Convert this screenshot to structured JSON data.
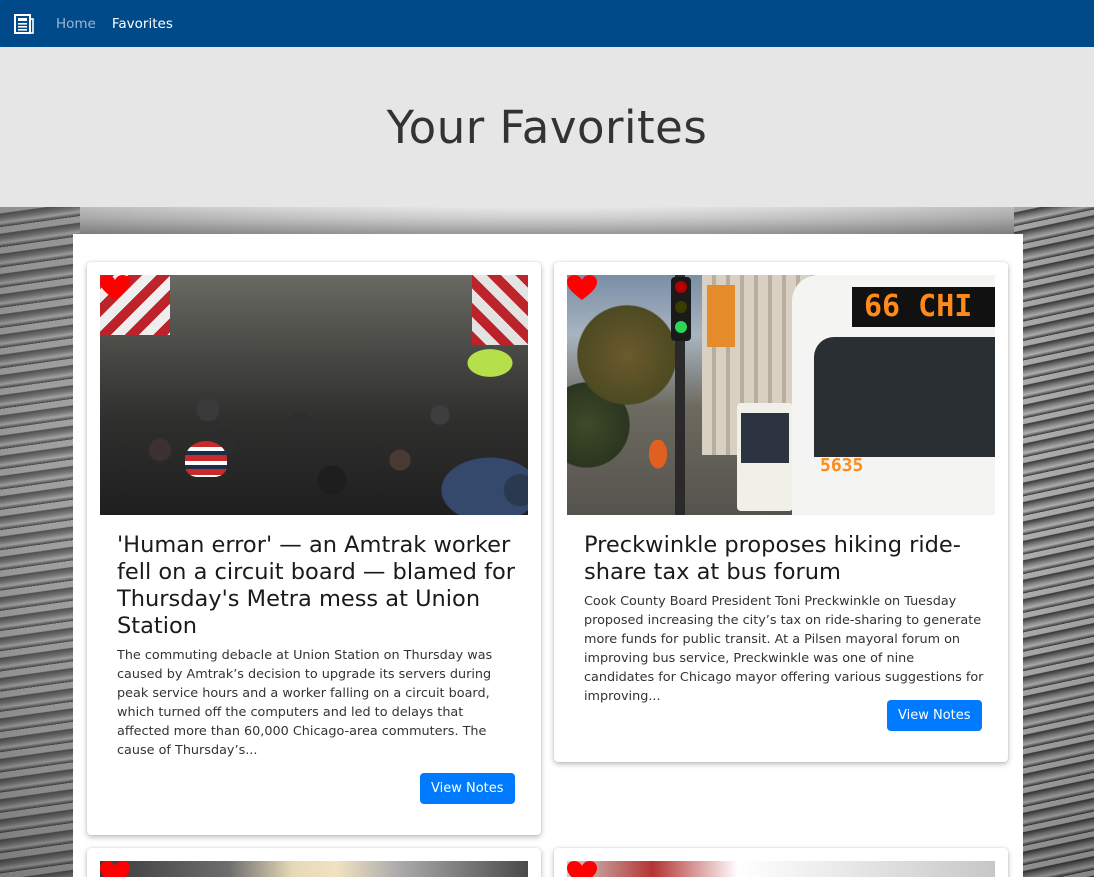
{
  "nav": {
    "brand_icon": "newspaper-icon",
    "links": [
      {
        "label": "Home"
      },
      {
        "label": "Favorites"
      }
    ]
  },
  "jumbotron": {
    "title": "Your Favorites"
  },
  "articles": [
    {
      "favorite": true,
      "title": "'Human error' — an Amtrak worker fell on a circuit board — blamed for Thursday's Metra mess at Union Station",
      "summary": "The commuting debacle at Union Station on Thursday was caused by Amtrak’s decision to upgrade its servers during peak service hours and a worker falling on a circuit board, which turned off the computers and led to delays that affected more than 60,000 Chicago-area commuters. The cause of Thursday’s...",
      "button": "View Notes"
    },
    {
      "favorite": true,
      "title": "Preckwinkle proposes hiking ride-share tax at bus forum",
      "summary": "Cook County Board President Toni Preckwinkle on Tuesday proposed increasing the city’s tax on ride-sharing to generate more funds for public transit. At a Pilsen mayoral forum on improving bus service, Preckwinkle was one of nine candidates for Chicago mayor offering various suggestions for improving...",
      "button": "View Notes",
      "image_sign": "66 CHI",
      "image_bus_number": "5635"
    },
    {
      "favorite": true
    },
    {
      "favorite": true
    }
  ],
  "colors": {
    "navbar": "#004a8a",
    "jumbotron": "#e6e6e6",
    "button": "#007bff",
    "heart": "#ff0000"
  }
}
